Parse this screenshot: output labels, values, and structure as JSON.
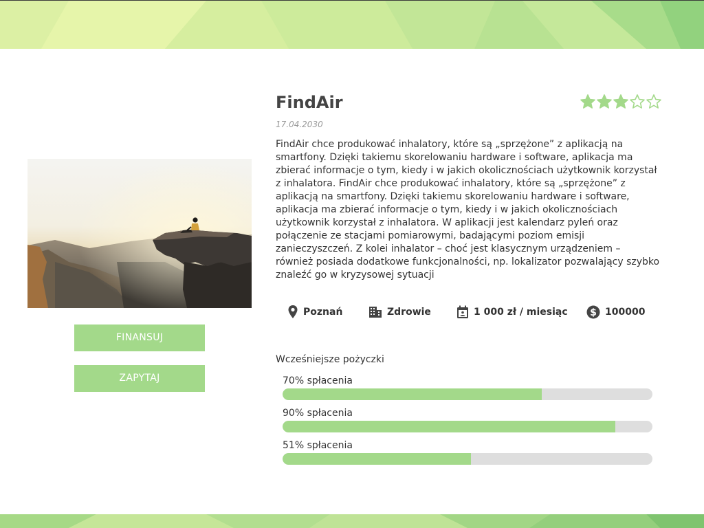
{
  "project": {
    "title": "FindAir",
    "date": "17.04.2030",
    "rating": 3,
    "rating_max": 5,
    "description": "FindAir chce produkować inhalatory, które są „sprzężone” z aplikacją na smartfony. Dzięki takiemu skorelowaniu hardware i software, aplikacja ma zbierać informacje o tym, kiedy i w jakich okolicznościach użytkownik korzystał z inhalatora. FindAir chce produkować inhalatory, które są „sprzężone” z aplikacją na smartfony. Dzięki takiemu skorelowaniu hardware i software, aplikacja ma zbierać informacje o tym, kiedy i w jakich okolicznościach użytkownik korzystał z inhalatora. W aplikacji jest kalendarz pyleń oraz połączenie ze stacjami pomiarowymi, badającymi poziom emisji zanieczyszczeń. Z kolei inhalator – choć jest klasycznym urządzeniem – również posiada dodatkowe funkcjonalności, np. lokalizator pozwalający szybko znaleźć go w kryzysowej sytuacji"
  },
  "actions": {
    "finance_label": "FINANSUJ",
    "ask_label": "ZAPYTAJ"
  },
  "meta": {
    "city": {
      "icon": "location-pin-icon",
      "label": "Poznań"
    },
    "category": {
      "icon": "building-icon",
      "label": "Zdrowie"
    },
    "installment": {
      "icon": "calendar-icon",
      "label": "1 000 zł / miesiąc"
    },
    "amount": {
      "icon": "dollar-coin-icon",
      "label": "100000"
    }
  },
  "loans": {
    "title": "Wcześniejsze pożyczki",
    "items": [
      {
        "label": "70% spłacenia",
        "percent": 70
      },
      {
        "label": "90% spłacenia",
        "percent": 90
      },
      {
        "label": "51% spłacenia",
        "percent": 51
      }
    ]
  },
  "colors": {
    "accent": "#a3d98a",
    "track": "#dedede",
    "star": "#a3d98a",
    "banner_light": "#e4f4a8",
    "banner_dark": "#8ccf7a"
  }
}
